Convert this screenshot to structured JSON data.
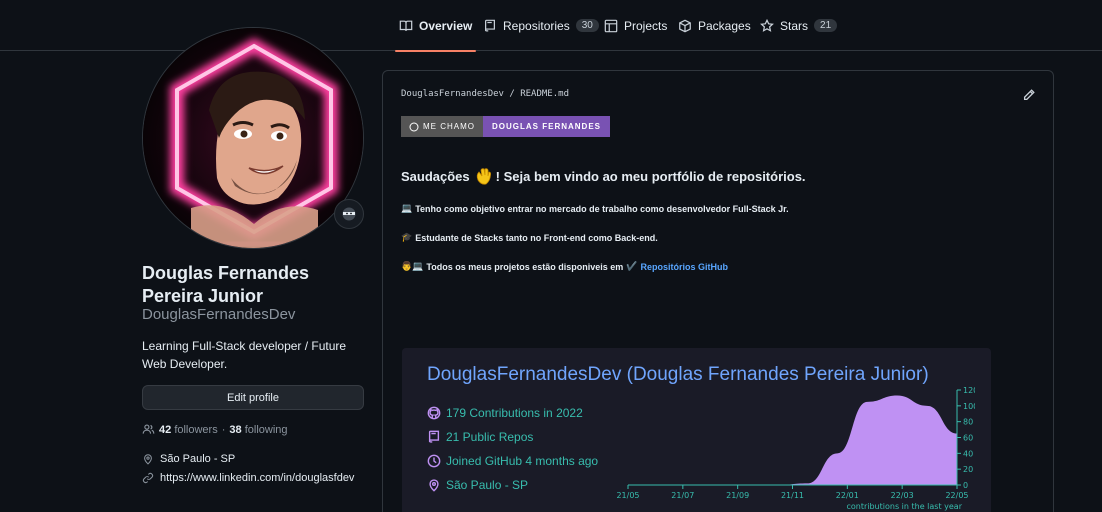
{
  "tabs": [
    {
      "label": "Overview",
      "icon": "book-icon"
    },
    {
      "label": "Repositories",
      "count": "30",
      "icon": "repo-icon"
    },
    {
      "label": "Projects",
      "icon": "table-icon"
    },
    {
      "label": "Packages",
      "icon": "package-icon"
    },
    {
      "label": "Stars",
      "count": "21",
      "icon": "star-icon"
    }
  ],
  "profile": {
    "full_name": "Douglas Fernandes Pereira Junior",
    "username": "DouglasFernandesDev",
    "bio": "Learning Full-Stack developer / Future Web Developer.",
    "edit_label": "Edit profile",
    "followers_count": "42",
    "followers_label": "followers",
    "separator": "·",
    "following_count": "38",
    "following_label": "following",
    "location": "São Paulo - SP",
    "link": "https://www.linkedin.com/in/douglasfdev"
  },
  "readme": {
    "path_user": "DouglasFernandesDev",
    "path_sep": "/",
    "path_file": "README.md",
    "badge_left": "ME CHAMO",
    "badge_right": "DOUGLAS FERNANDES",
    "greeting_pre": "Saudações",
    "greeting_emoji": "👋",
    "greeting_post": "! Seja bem vindo ao meu portfólio de repositórios.",
    "line1_emoji": "💻",
    "line1": "Tenho como objetivo entrar no mercado de trabalho como desenvolvedor Full-Stack Jr.",
    "line2_emoji": "🎓",
    "line2": "Estudante de Stacks tanto no Front-end como Back-end.",
    "line3_emoji": "👨💻",
    "line3": "Todos os meus projetos estão disponiveis em",
    "line3_check": "✔️",
    "line3_link": "Repositórios GitHub"
  },
  "stats_card": {
    "title": "DouglasFernandesDev (Douglas Fernandes Pereira Junior)",
    "items": [
      {
        "icon": "github-icon",
        "text": "179 Contributions in 2022"
      },
      {
        "icon": "repo-icon",
        "text": "21 Public Repos"
      },
      {
        "icon": "clock-icon",
        "text": "Joined GitHub 4 months ago"
      },
      {
        "icon": "location-icon",
        "text": "São Paulo - SP"
      }
    ]
  },
  "chart_data": {
    "type": "area",
    "x": [
      "21/05",
      "21/07",
      "21/09",
      "21/11",
      "22/01",
      "22/03",
      "22/05"
    ],
    "series": [
      {
        "x": [
          "21/05",
          "21/07",
          "21/09",
          "21/11",
          "22/01",
          "22/02",
          "22/03",
          "22/03b",
          "22/04a",
          "22/04b",
          "22/04c",
          "22/05"
        ],
        "values": [
          0,
          0,
          0,
          0,
          0,
          0,
          2,
          40,
          105,
          113,
          100,
          65
        ]
      }
    ],
    "xlabel": "contributions in the last year",
    "ylabel": "",
    "yticks": [
      0,
      20,
      40,
      60,
      80,
      100,
      120
    ],
    "ylim": [
      0,
      120
    ],
    "colors": {
      "area": "#bf91f3",
      "axis": "#38bdae"
    }
  },
  "colors": {
    "background": "#0d1117",
    "accent_tab": "#f78166",
    "link": "#58a6ff",
    "badge_purple": "#7952b3",
    "card_bg": "#1a1b27",
    "card_title": "#70a5fd",
    "card_text": "#38bdae",
    "card_icon": "#bf91f3"
  }
}
